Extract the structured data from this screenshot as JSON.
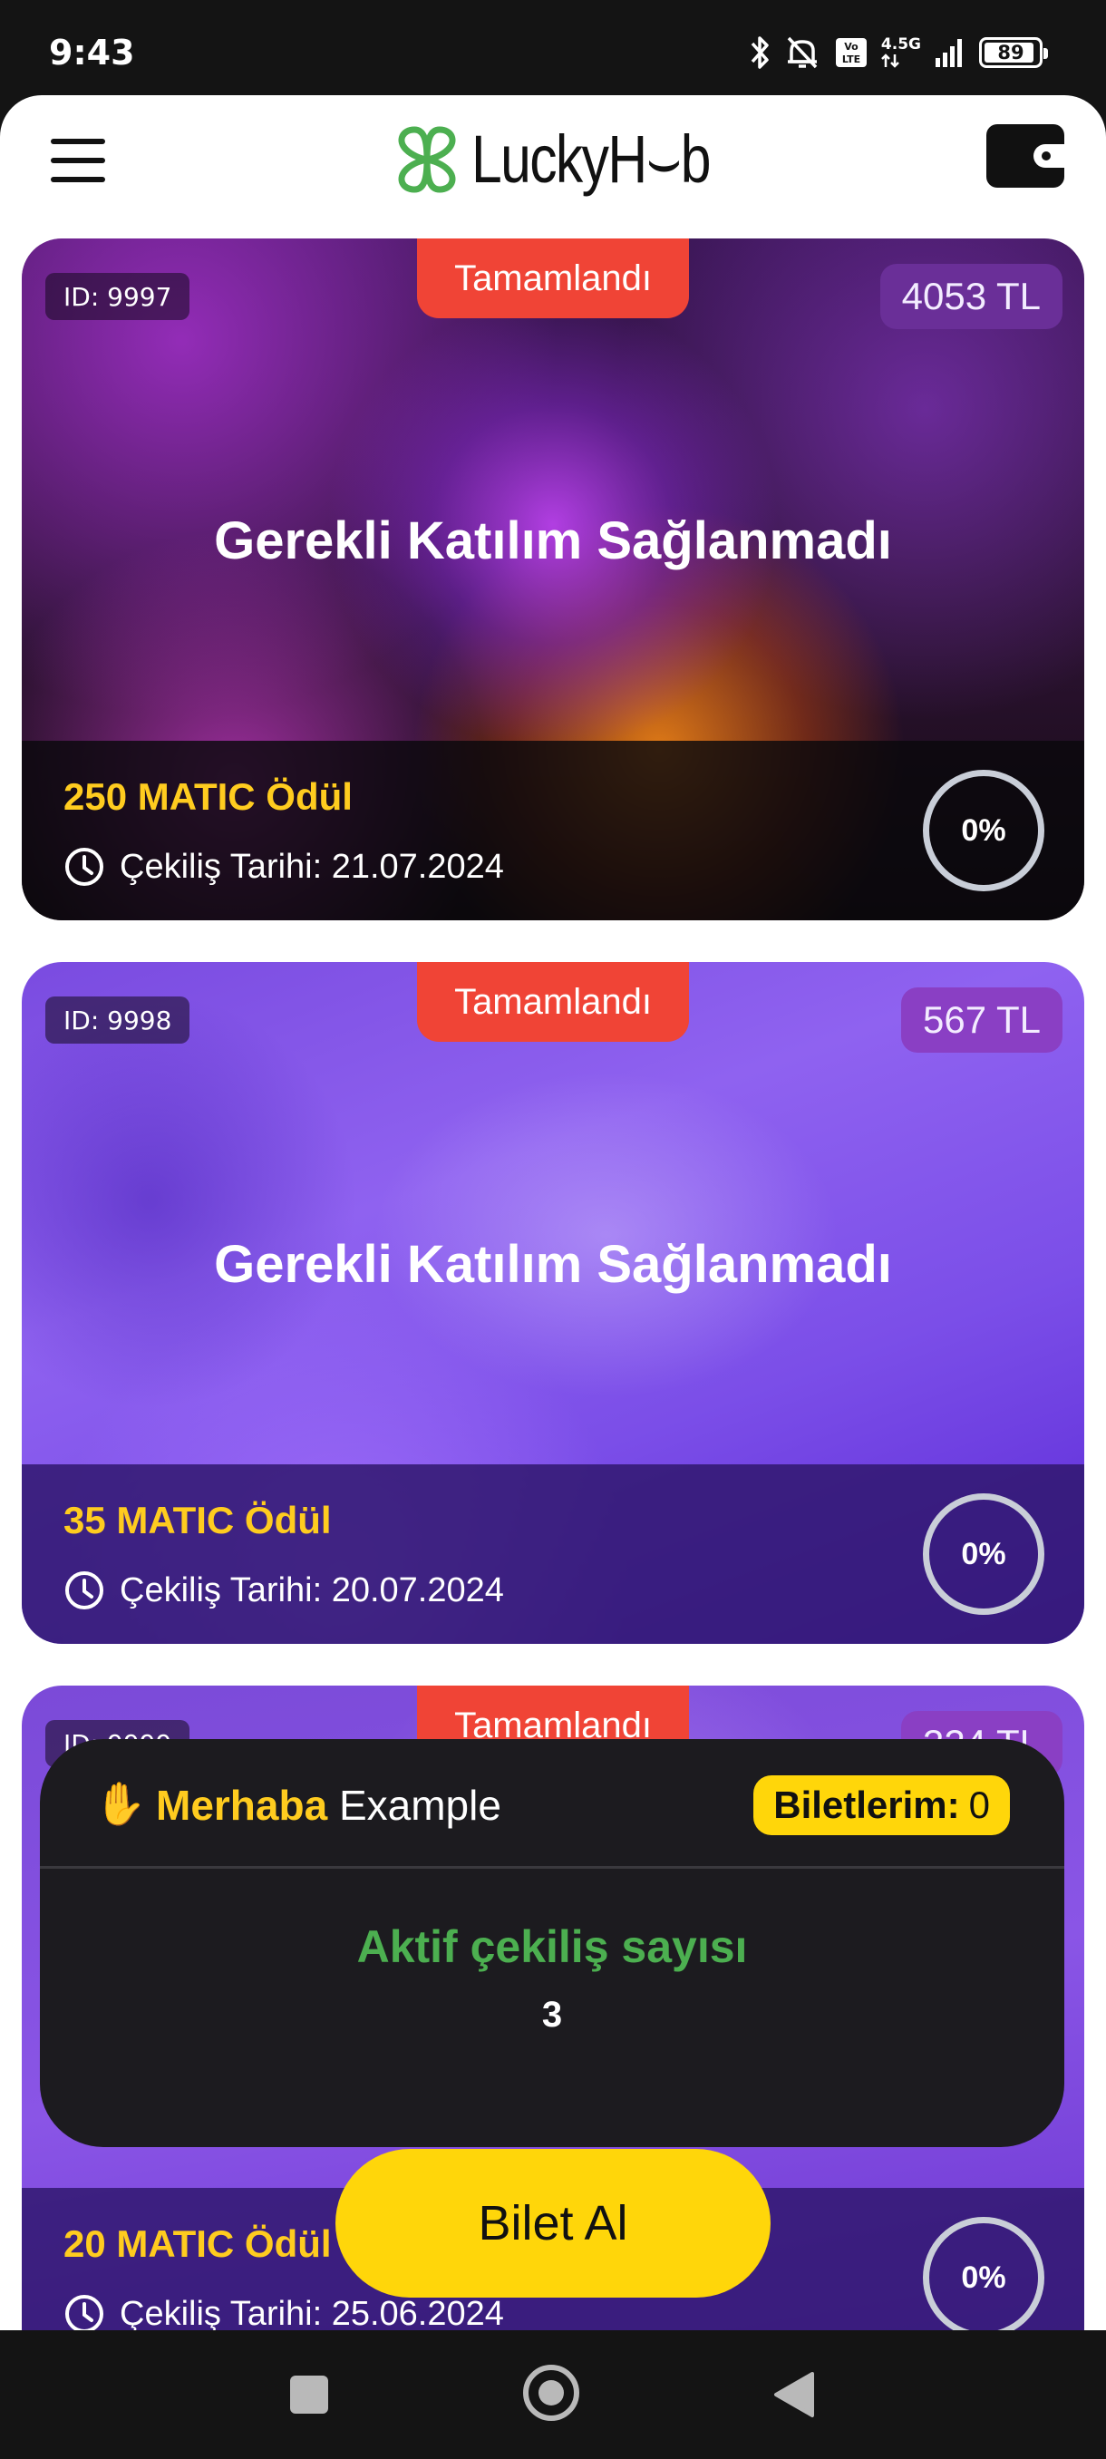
{
  "status_bar": {
    "time": "9:43",
    "network": "4.5G",
    "battery": "89",
    "icons": [
      "bluetooth-icon",
      "mute-icon",
      "volte-icon",
      "signal-icon",
      "battery-icon"
    ]
  },
  "header": {
    "logo_text": "LuckyH⌣b",
    "menu_icon": "hamburger-menu-icon",
    "wallet_icon": "wallet-icon"
  },
  "cards": [
    {
      "id_label": "ID: 9997",
      "status": "Tamamlandı",
      "price": "4053 TL",
      "message": "Gerekli Katılım Sağlanmadı",
      "prize": "250 MATIC Ödül",
      "draw_date": "Çekiliş Tarihi: 21.07.2024",
      "progress": "0%"
    },
    {
      "id_label": "ID: 9998",
      "status": "Tamamlandı",
      "price": "567 TL",
      "message": "Gerekli Katılım Sağlanmadı",
      "prize": "35 MATIC Ödül",
      "draw_date": "Çekiliş Tarihi: 20.07.2024",
      "progress": "0%"
    },
    {
      "id_label": "ID: 9999",
      "status": "Tamamlandı",
      "price": "324 TL",
      "prize": "20 MATIC Ödül",
      "draw_date": "Çekiliş Tarihi: 25.06.2024",
      "progress": "0%"
    }
  ],
  "welcome": {
    "wave_icon": "waving-hand-icon",
    "greeting": "Merhaba",
    "username": "Example",
    "tickets_label": "Biletlerim:",
    "tickets_count": "0",
    "active_label": "Aktif çekiliş sayısı",
    "active_count": "3"
  },
  "buy_button": "Bilet Al",
  "colors": {
    "accent_yellow": "#ffd60a",
    "status_red": "#f04436",
    "active_green": "#4caf50",
    "prize_gold": "#ffcc1f"
  }
}
